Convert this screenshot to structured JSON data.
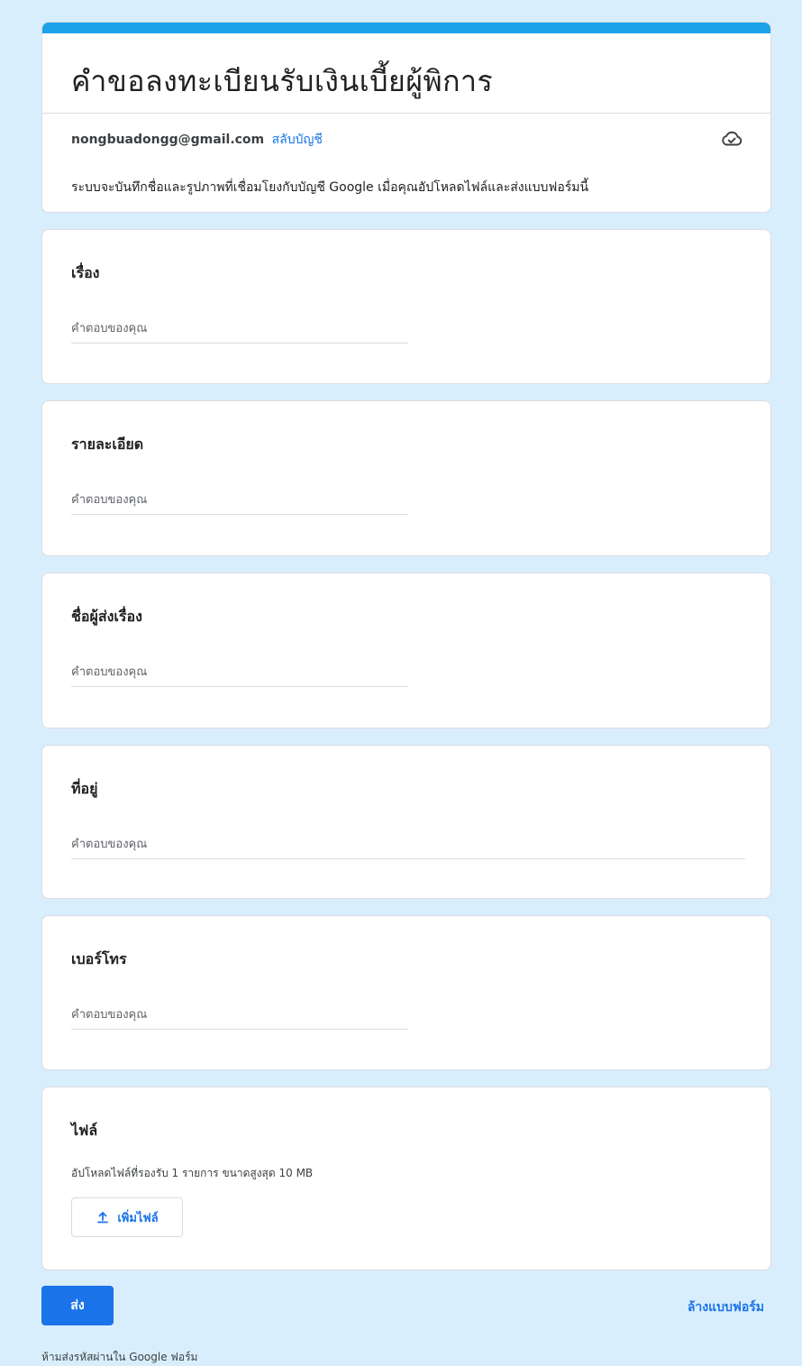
{
  "form": {
    "title": "คำขอลงทะเบียนรับเงินเบี้ยผู้พิการ",
    "accent_color": "#1aa3e8",
    "account_email": "nongbuadongg@gmail.com",
    "switch_account": "สลับบัญชี",
    "cloud_icon": "cloud-saved-icon",
    "notice": "ระบบจะบันทึกชื่อและรูปภาพที่เชื่อมโยงกับบัญชี Google เมื่อคุณอัปโหลดไฟล์และส่งแบบฟอร์มนี้"
  },
  "questions": [
    {
      "title": "เรื่อง",
      "placeholder": "คำตอบของคุณ"
    },
    {
      "title": "รายละเอียด",
      "placeholder": "คำตอบของคุณ"
    },
    {
      "title": "ชื่อผู้ส่งเรื่อง",
      "placeholder": "คำตอบของคุณ"
    },
    {
      "title": "ที่อยู่",
      "placeholder": "คำตอบของคุณ"
    },
    {
      "title": "เบอร์โทร",
      "placeholder": "คำตอบของคุณ"
    }
  ],
  "file_question": {
    "title": "ไฟล์",
    "subtitle": "อัปโหลดไฟล์ที่รองรับ 1 รายการ ขนาดสูงสุด 10 MB",
    "button_label": "เพิ่มไฟล์",
    "button_icon": "upload-icon"
  },
  "actions": {
    "submit_label": "ส่ง",
    "clear_label": "ล้างแบบฟอร์ม"
  },
  "footer": {
    "note": "ห้ามส่งรหัสผ่านใน Google ฟอร์ม"
  }
}
